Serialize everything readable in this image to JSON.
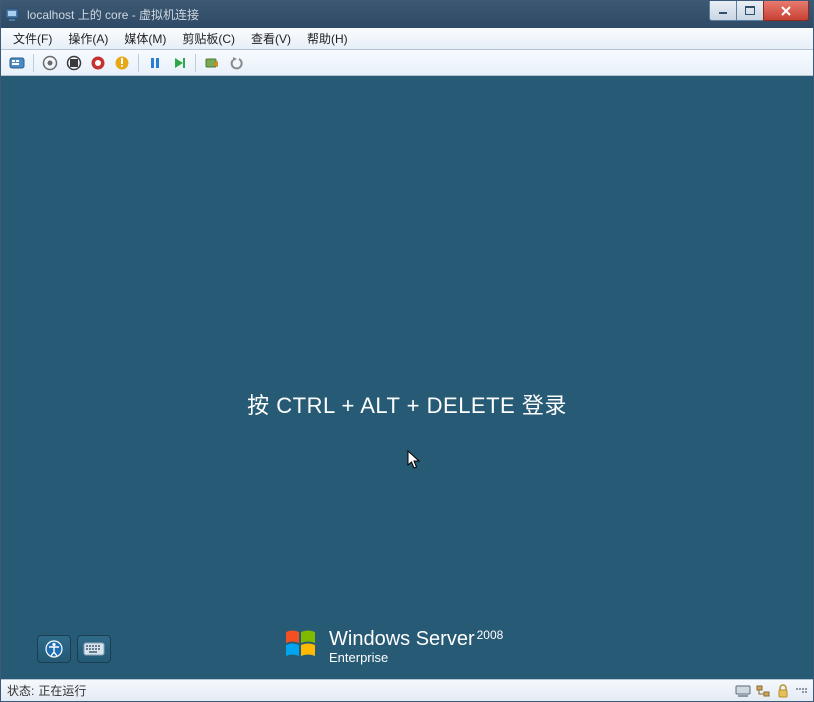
{
  "titlebar": {
    "title": "localhost 上的 core - 虚拟机连接"
  },
  "menubar": {
    "items": [
      {
        "label": "文件(F)"
      },
      {
        "label": "操作(A)"
      },
      {
        "label": "媒体(M)"
      },
      {
        "label": "剪贴板(C)"
      },
      {
        "label": "查看(V)"
      },
      {
        "label": "帮助(H)"
      }
    ]
  },
  "vm": {
    "login_prompt": "按 CTRL + ALT + DELETE 登录",
    "brand_line1_a": "Windows",
    "brand_line1_b": "Server",
    "brand_year": "2008",
    "brand_line2": "Enterprise"
  },
  "statusbar": {
    "label": "状态:",
    "value": "正在运行"
  }
}
